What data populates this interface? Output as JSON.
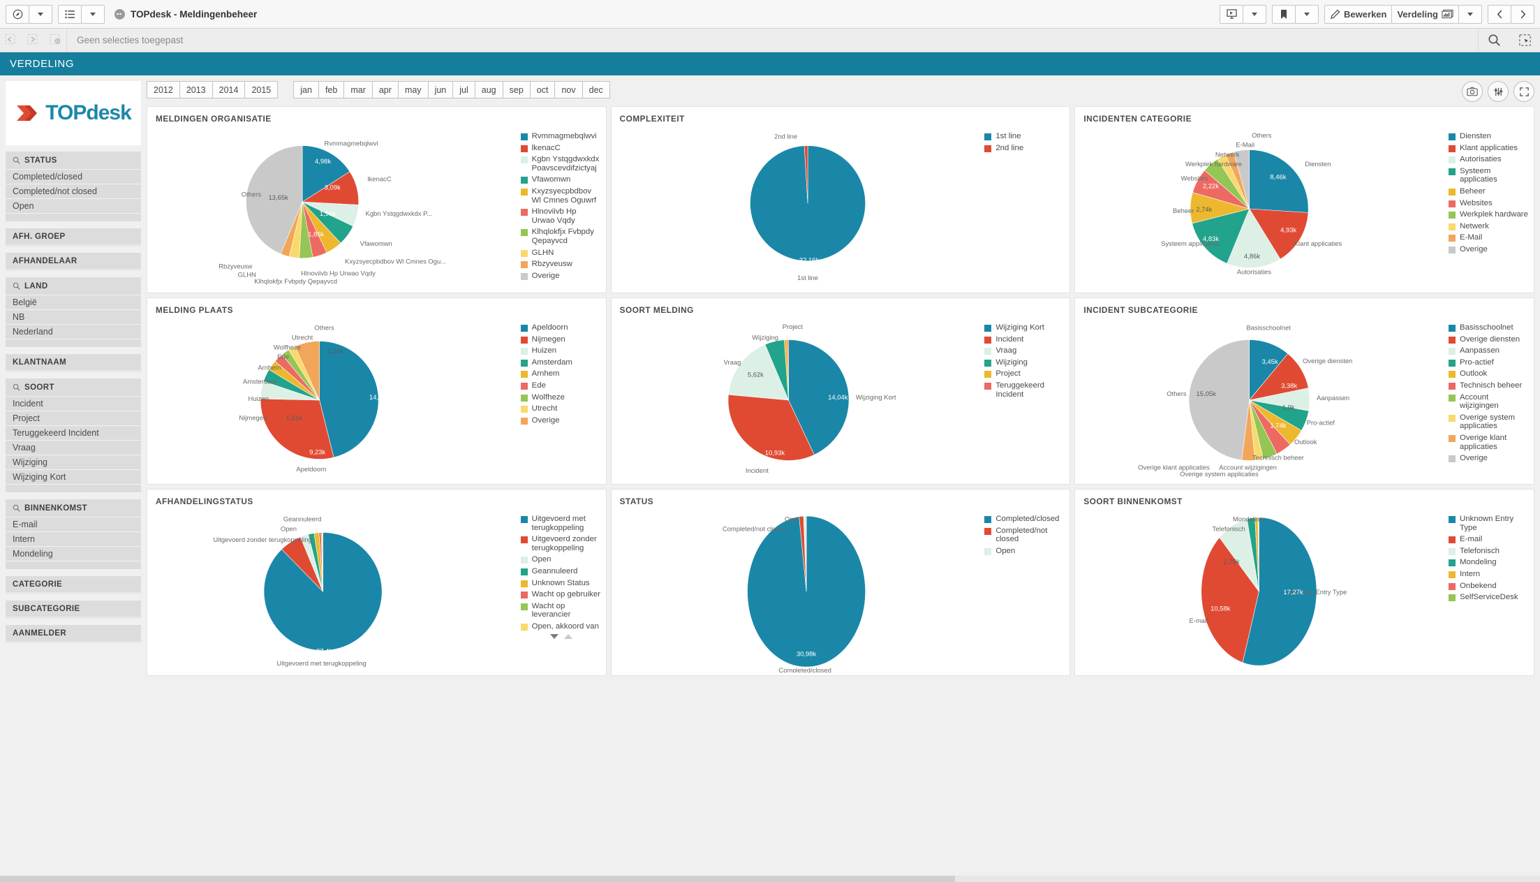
{
  "topbar": {
    "app_title": "TOPdesk - Meldingenbeheer",
    "nav_icon": "compass-icon",
    "sheets_icon": "list-icon",
    "story_icon": "presentation-icon",
    "bookmark_icon": "bookmark-icon",
    "edit_label": "Bewerken",
    "sheet_label": "Verdeling",
    "prev_label": "‹",
    "next_label": "›"
  },
  "selectionbar": {
    "placeholder": "Geen selecties toegepast",
    "back_icon": "selection-back-icon",
    "forward_icon": "selection-forward-icon",
    "clear_icon": "selection-clear-icon",
    "search_icon": "search-icon",
    "lasso_icon": "selection-tool-icon"
  },
  "page_title": "VERDELING",
  "sidebar": {
    "logo_text_1": "TOP",
    "logo_text_2": "desk",
    "filters": [
      {
        "title": "STATUS",
        "searchable": true,
        "items": [
          "Completed/closed",
          "Completed/not closed",
          "Open"
        ]
      },
      {
        "title": "AFH. GROEP",
        "searchable": false,
        "items": []
      },
      {
        "title": "AFHANDELAAR",
        "searchable": false,
        "items": []
      },
      {
        "title": "LAND",
        "searchable": true,
        "items": [
          "België",
          "NB",
          "Nederland"
        ]
      },
      {
        "title": "KLANTNAAM",
        "searchable": false,
        "items": []
      },
      {
        "title": "SOORT",
        "searchable": true,
        "items": [
          "Incident",
          "Project",
          "Teruggekeerd Incident",
          "Vraag",
          "Wijziging",
          "Wijziging Kort"
        ]
      },
      {
        "title": "BINNENKOMST",
        "searchable": true,
        "items": [
          "E-mail",
          "Intern",
          "Mondeling"
        ]
      },
      {
        "title": "CATEGORIE",
        "searchable": false,
        "items": []
      },
      {
        "title": "SUBCATEGORIE",
        "searchable": false,
        "items": []
      },
      {
        "title": "AANMELDER",
        "searchable": false,
        "items": []
      }
    ]
  },
  "toolbar": {
    "years": [
      "2012",
      "2013",
      "2014",
      "2015"
    ],
    "months": [
      "jan",
      "feb",
      "mar",
      "apr",
      "may",
      "jun",
      "jul",
      "aug",
      "sep",
      "oct",
      "nov",
      "dec"
    ],
    "snapshot_icon": "camera-icon",
    "sort_icon": "sort-icon",
    "fullscreen_icon": "fullscreen-icon"
  },
  "chart_data": [
    {
      "type": "pie",
      "title": "MELDINGEN ORGANISATIE",
      "legend_position": "right",
      "start_angle": 0,
      "categories": [
        "Rvmmagmebqlwvi",
        "lkenacC",
        "Kgbn Ystqgdwxkdx Poavscevdifzictyaj",
        "Vfawomwn",
        "Kxyzsyecpbdbov Wl Cmnes Oguwrf",
        "Hlnoviivb Hp Urwao Vqdy",
        "Klhqlokfjx Fvbpdy Qepayvcd",
        "GLHN",
        "Rbzyveusw",
        "Overige"
      ],
      "values": [
        4980,
        3090,
        1960,
        1860,
        1500,
        1300,
        1200,
        900,
        800,
        13650
      ],
      "value_labels": [
        "4,98k",
        "3,09k",
        "1,96k",
        "1,86k",
        "",
        "",
        "",
        "",
        "",
        "13,65k"
      ],
      "slice_labels": [
        "Rvmmagmebqlwvi",
        "lkenacC",
        "Kgbn Ystqgdwxkdx P...",
        "Vfawomwn",
        "Kxyzsyecpbdbov Wl Cmnes Ogu...",
        "Hlnoviivb Hp Urwao Vqdy",
        "Klhqlokfjx Fvbpdy Qepayvcd",
        "GLHN",
        "Rbzyveusw",
        "Others"
      ],
      "colors": [
        "#1a87a8",
        "#e04a33",
        "#dcf0e6",
        "#22a38b",
        "#edb82e",
        "#ed6a63",
        "#95c655",
        "#f9d96b",
        "#f2a65a",
        "#c9c9c9"
      ]
    },
    {
      "type": "pie",
      "title": "COMPLEXITEIT",
      "legend_position": "right",
      "categories": [
        "1st line",
        "2nd line"
      ],
      "values": [
        32160,
        310
      ],
      "value_labels": [
        "32,16k",
        ""
      ],
      "slice_labels": [
        "1st line",
        "2nd line"
      ],
      "colors": [
        "#1a87a8",
        "#e04a33"
      ]
    },
    {
      "type": "pie",
      "title": "INCIDENTEN CATEGORIE",
      "legend_position": "right",
      "categories": [
        "Diensten",
        "Klant applicaties",
        "Autorisaties",
        "Systeem applicaties",
        "Beheer",
        "Websites",
        "Werkplek hardware",
        "Netwerk",
        "E-Mail",
        "Overige"
      ],
      "values": [
        8460,
        4930,
        4860,
        4830,
        2740,
        2220,
        1500,
        800,
        750,
        1400
      ],
      "value_labels": [
        "8,46k",
        "4,93k",
        "4,86k",
        "4,83k",
        "2,74k",
        "2,22k",
        "",
        "",
        "",
        ""
      ],
      "slice_labels": [
        "Diensten",
        "Klant applicaties",
        "Autorisaties",
        "Systeem applicaties",
        "Beheer",
        "Websites",
        "Werkplek hardware",
        "Netwerk",
        "E-Mail",
        "Others"
      ],
      "colors": [
        "#1a87a8",
        "#e04a33",
        "#dcf0e6",
        "#22a38b",
        "#edb82e",
        "#ed6a63",
        "#95c655",
        "#f9d96b",
        "#f2a65a",
        "#c9c9c9"
      ]
    },
    {
      "type": "pie",
      "title": "MELDING PLAATS",
      "legend_position": "right",
      "categories": [
        "Apeldoorn",
        "Nijmegen",
        "Huizen",
        "Amsterdam",
        "Arnhem",
        "Ede",
        "Wolfheze",
        "Utrecht",
        "Overige"
      ],
      "values": [
        14550,
        9230,
        1510,
        1100,
        900,
        800,
        700,
        600,
        2160
      ],
      "value_labels": [
        "14,55k",
        "9,23k",
        "1,51k",
        "",
        "",
        "",
        "",
        "",
        "2,16k"
      ],
      "slice_labels": [
        "Apeldoorn",
        "Apeldoorn",
        "Nijmegen",
        "Huizen",
        "Amsterdam",
        "Arnhem",
        "Ede",
        "Wolfheze",
        "Utrecht",
        "Others"
      ],
      "colors": [
        "#1a87a8",
        "#e04a33",
        "#dcf0e6",
        "#22a38b",
        "#edb82e",
        "#ed6a63",
        "#95c655",
        "#f9d96b",
        "#f2a65a",
        "#c9c9c9"
      ]
    },
    {
      "type": "pie",
      "title": "SOORT MELDING",
      "legend_position": "right",
      "categories": [
        "Wijziging Kort",
        "Incident",
        "Vraag",
        "Wijziging",
        "Project",
        "Teruggekeerd Incident"
      ],
      "values": [
        14040,
        10930,
        5620,
        1700,
        260,
        110
      ],
      "value_labels": [
        "14,04k",
        "10,93k",
        "5,62k",
        "",
        "",
        ""
      ],
      "slice_labels": [
        "Wijziging Kort",
        "Incident",
        "Vraag",
        "Wijziging",
        "Project",
        ""
      ],
      "colors": [
        "#1a87a8",
        "#e04a33",
        "#dcf0e6",
        "#22a38b",
        "#edb82e",
        "#ed6a63"
      ]
    },
    {
      "type": "pie",
      "title": "INCIDENT SUBCATEGORIE",
      "legend_position": "right",
      "categories": [
        "Basisschoolnet",
        "Overige diensten",
        "Aanpassen",
        "Pro-actief",
        "Outlook",
        "Technisch beheer",
        "Account wijzigingen",
        "Overige system applicaties",
        "Overige klant applicaties",
        "Overige"
      ],
      "values": [
        3450,
        3380,
        1900,
        1740,
        1500,
        1350,
        1200,
        700,
        1100,
        15050
      ],
      "value_labels": [
        "3,45k",
        "3,38k",
        "1,9k",
        "1,74k",
        "",
        "",
        "",
        "",
        "",
        "15,05k"
      ],
      "slice_labels": [
        "Basisschoolnet",
        "Overige diensten",
        "Aanpassen",
        "Pro-actief",
        "Outlook",
        "Technisch beheer",
        "Account wijzigingen",
        "Overige system applicaties",
        "Overige klant applicaties",
        "Others"
      ],
      "colors": [
        "#1a87a8",
        "#e04a33",
        "#dcf0e6",
        "#22a38b",
        "#edb82e",
        "#ed6a63",
        "#95c655",
        "#f9d96b",
        "#f2a65a",
        "#c9c9c9"
      ]
    },
    {
      "type": "pie",
      "title": "AFHANDELINGSTATUS",
      "legend_position": "right",
      "categories": [
        "Uitgevoerd met terugkoppeling",
        "Uitgevoerd zonder terugkoppeling",
        "Open",
        "Geannuleerd",
        "Unknown Status",
        "Wacht op gebruiker",
        "Wacht op leverancier",
        "Open, akkoord van"
      ],
      "values": [
        27400,
        1900,
        700,
        500,
        420,
        180,
        90,
        60
      ],
      "value_labels": [
        "27,4k",
        "",
        "",
        "",
        "",
        "",
        "",
        ""
      ],
      "slice_labels": [
        "Uitgevoerd met terugkoppeling",
        "Uitgevoerd zonder terugkoppeling",
        "Open",
        "Geannuleerd",
        "",
        "",
        "",
        ""
      ],
      "colors": [
        "#1a87a8",
        "#e04a33",
        "#dcf0e6",
        "#22a38b",
        "#edb82e",
        "#ed6a63",
        "#95c655",
        "#f9d96b"
      ],
      "has_scroll": true
    },
    {
      "type": "pie",
      "title": "STATUS",
      "legend_position": "right",
      "categories": [
        "Completed/closed",
        "Completed/not closed",
        "Open"
      ],
      "values": [
        30980,
        380,
        240
      ],
      "value_labels": [
        "30,98k",
        "",
        ""
      ],
      "slice_labels": [
        "Completed/closed",
        "Completed/not closed",
        "Open"
      ],
      "colors": [
        "#1a87a8",
        "#e04a33",
        "#dcf0e6"
      ]
    },
    {
      "type": "pie",
      "title": "SOORT BINNENKOMST",
      "legend_position": "right",
      "categories": [
        "Unknown Entry Type",
        "E-mail",
        "Telefonisch",
        "Mondeling",
        "Intern",
        "Onbekend",
        "SelfServiceDesk"
      ],
      "values": [
        17270,
        10580,
        2750,
        700,
        260,
        60,
        30
      ],
      "value_labels": [
        "17,27k",
        "10,58k",
        "2,75k",
        "",
        "",
        "",
        ""
      ],
      "slice_labels": [
        "Unknown Entry Type",
        "E-mail",
        "Telefonisch",
        "Mondeling",
        "",
        "",
        ""
      ],
      "colors": [
        "#1a87a8",
        "#e04a33",
        "#dcf0e6",
        "#22a38b",
        "#edb82e",
        "#ed6a63",
        "#95c655"
      ]
    }
  ],
  "theme": {
    "accent": "#157e9c",
    "brand_red": "#e04a33",
    "brand_blue": "#1a87a8",
    "panel_bg": "#ffffff",
    "page_bg": "#f0f0f0"
  }
}
